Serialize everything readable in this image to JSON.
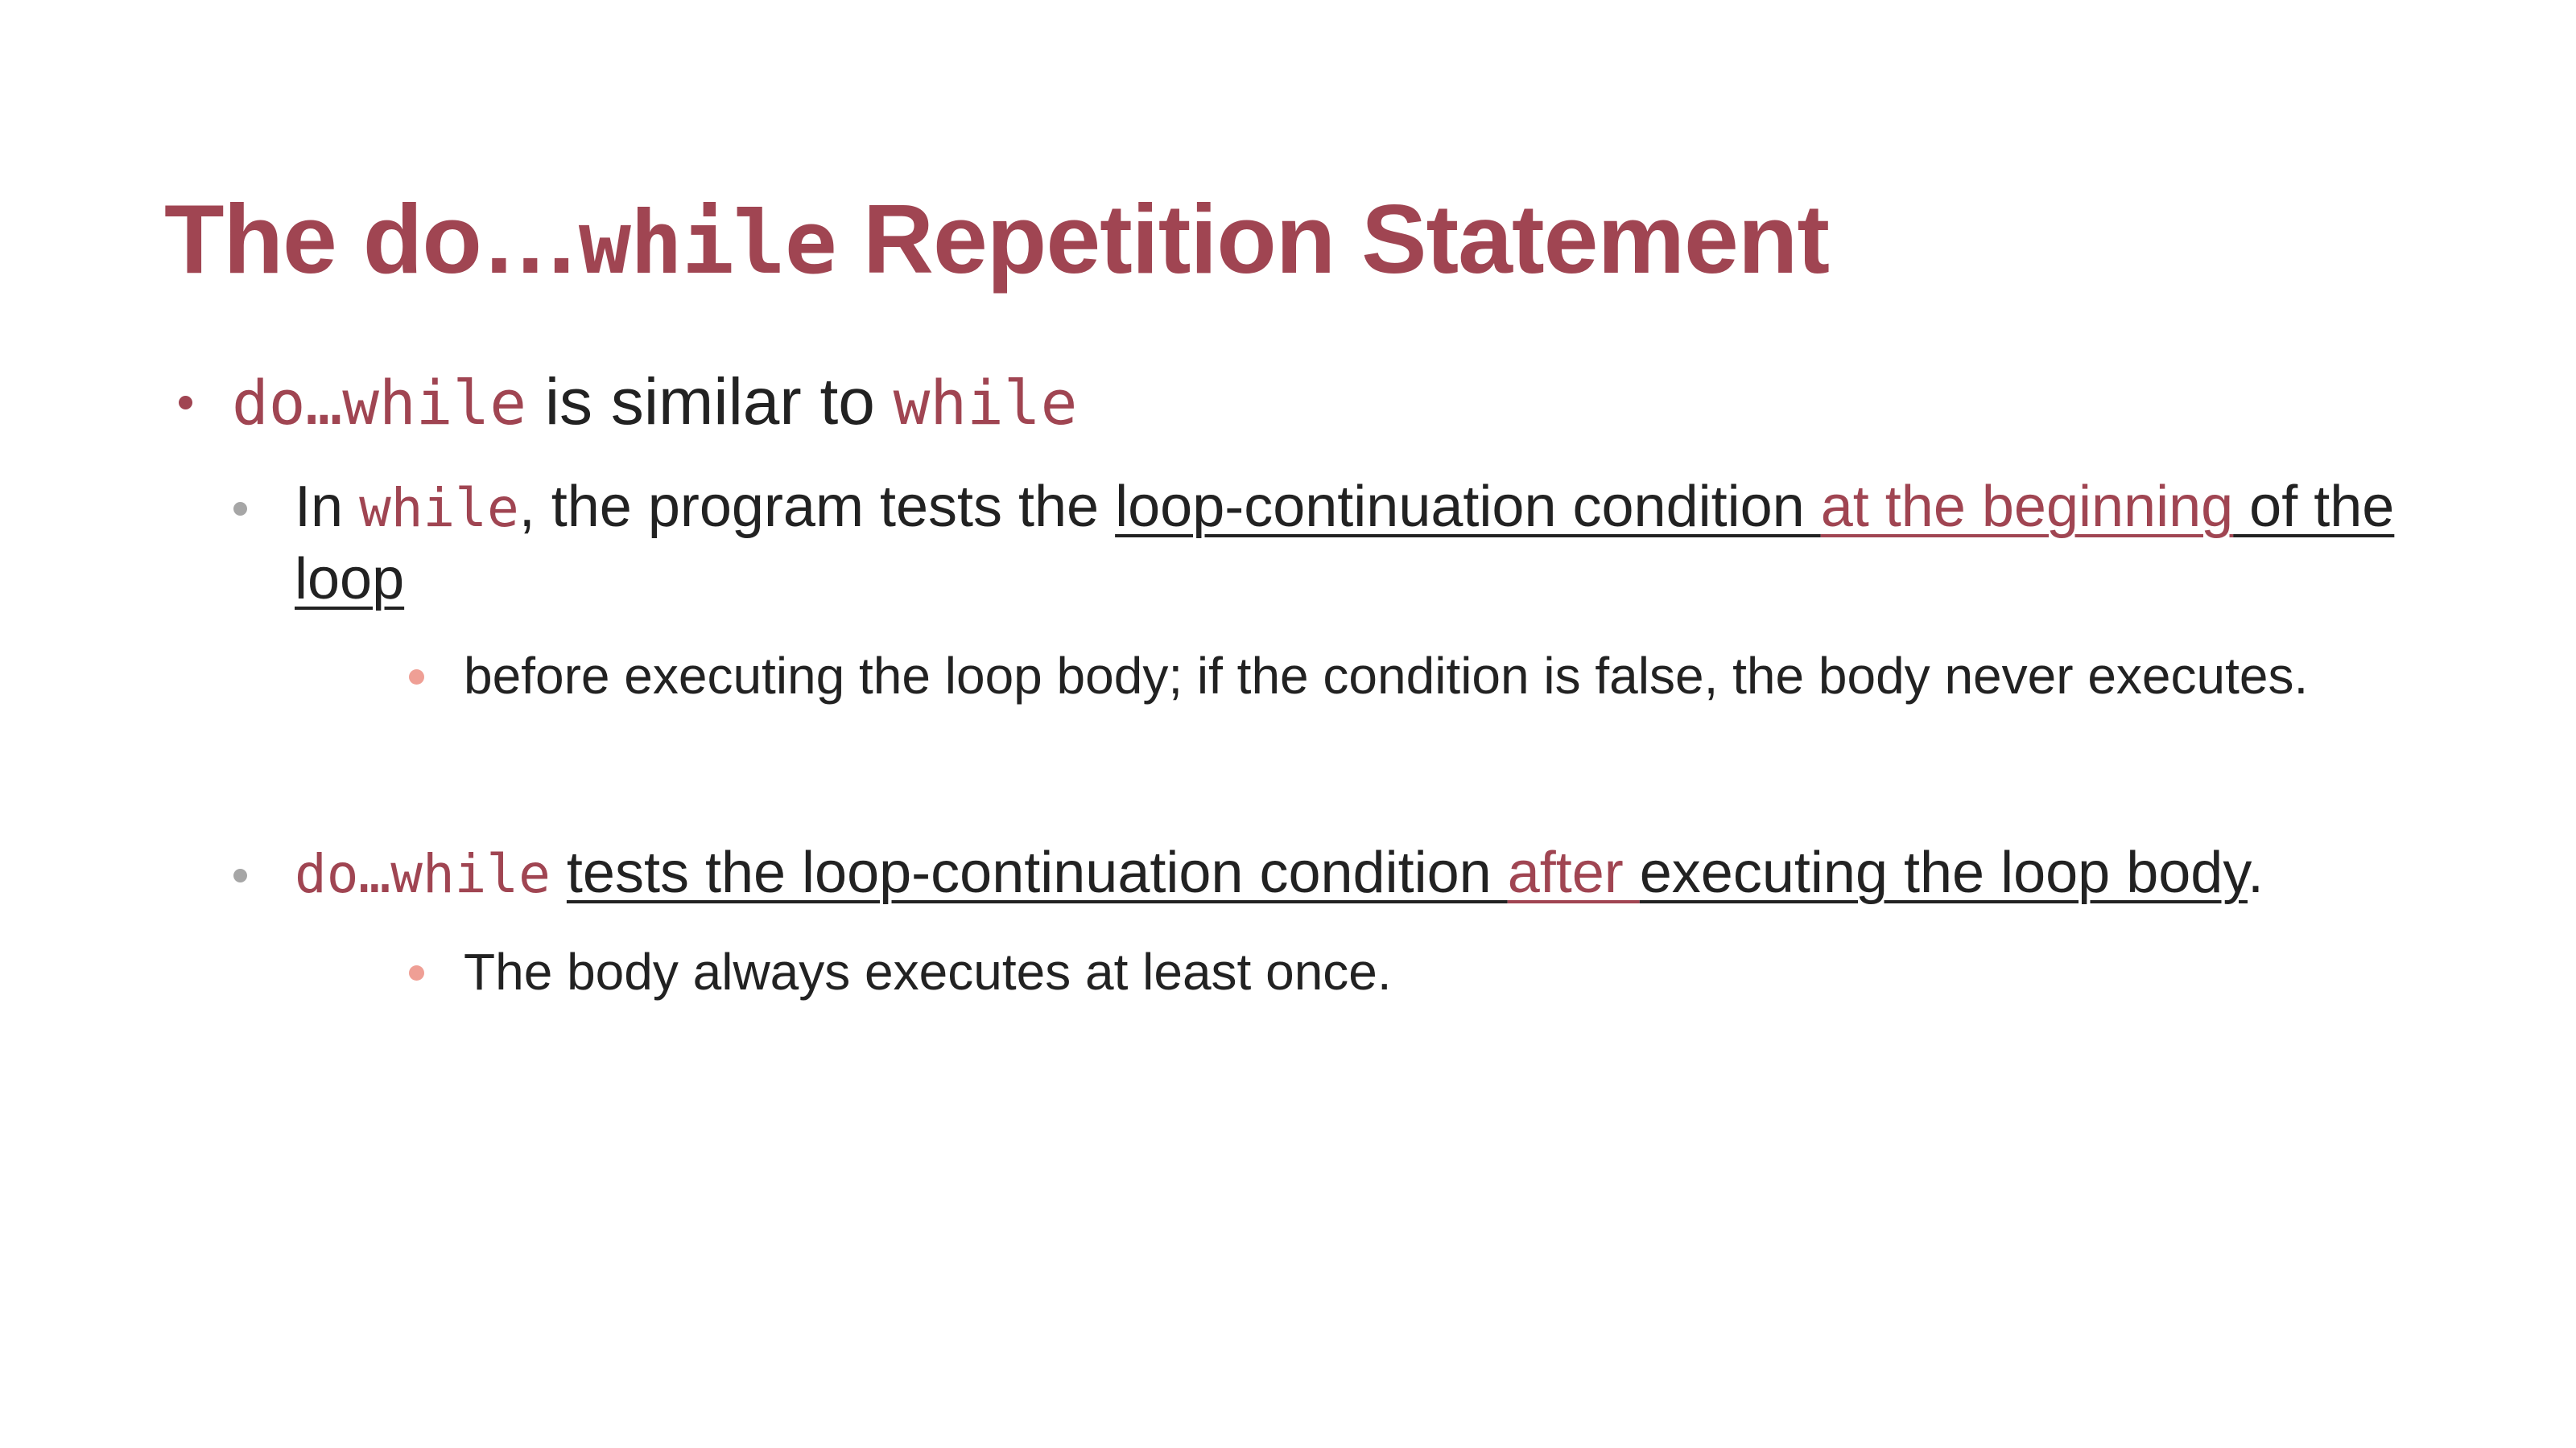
{
  "slide": {
    "title": {
      "prefix": "The do…",
      "code": "while",
      "suffix": " Repetition Statement"
    },
    "bullets": [
      {
        "code_a": "do…while",
        "text": " is similar to ",
        "code_b": "while"
      },
      {
        "prefix": "In ",
        "code": "while",
        "text": ", the program tests the ",
        "underlined_1": "loop-continuation condition ",
        "underlined_accent": "at the beginning",
        "underlined_2": " of the",
        "underlined_3": "loop"
      },
      {
        "text": "before executing the loop body; if the condition is false, the body never executes."
      },
      {
        "code": "do…while",
        "space": " ",
        "underlined_1": "tests the loop-continuation condition ",
        "underlined_accent": "after ",
        "underlined_2": "executing the loop body",
        "end": "."
      },
      {
        "text": "The body always executes at least once."
      }
    ]
  },
  "colors": {
    "accent": "#a04552",
    "text": "#222222",
    "bullet_level2": "#a6a6a6",
    "bullet_level3": "#ef9f95"
  }
}
